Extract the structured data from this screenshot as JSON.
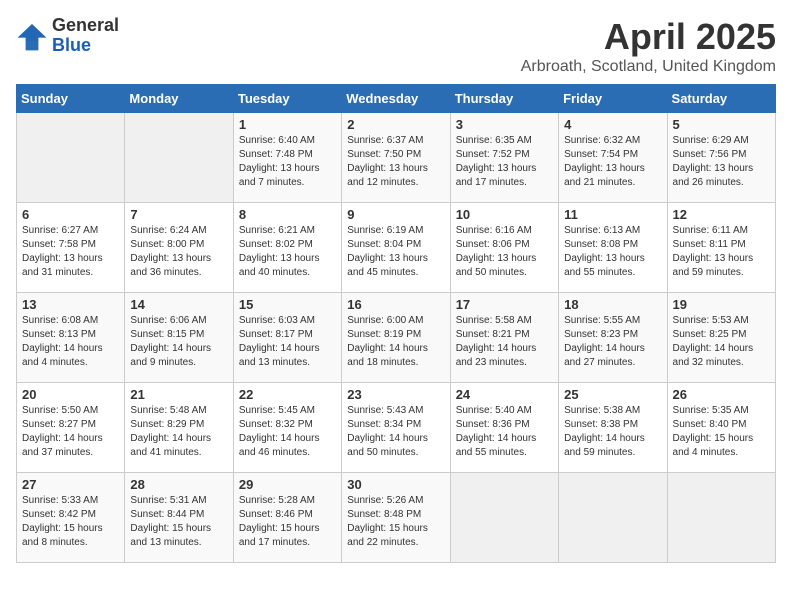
{
  "logo": {
    "general": "General",
    "blue": "Blue"
  },
  "title": "April 2025",
  "subtitle": "Arbroath, Scotland, United Kingdom",
  "days_of_week": [
    "Sunday",
    "Monday",
    "Tuesday",
    "Wednesday",
    "Thursday",
    "Friday",
    "Saturday"
  ],
  "weeks": [
    [
      {
        "day": "",
        "sunrise": "",
        "sunset": "",
        "daylight": "",
        "empty": true
      },
      {
        "day": "",
        "sunrise": "",
        "sunset": "",
        "daylight": "",
        "empty": true
      },
      {
        "day": "1",
        "sunrise": "Sunrise: 6:40 AM",
        "sunset": "Sunset: 7:48 PM",
        "daylight": "Daylight: 13 hours and 7 minutes."
      },
      {
        "day": "2",
        "sunrise": "Sunrise: 6:37 AM",
        "sunset": "Sunset: 7:50 PM",
        "daylight": "Daylight: 13 hours and 12 minutes."
      },
      {
        "day": "3",
        "sunrise": "Sunrise: 6:35 AM",
        "sunset": "Sunset: 7:52 PM",
        "daylight": "Daylight: 13 hours and 17 minutes."
      },
      {
        "day": "4",
        "sunrise": "Sunrise: 6:32 AM",
        "sunset": "Sunset: 7:54 PM",
        "daylight": "Daylight: 13 hours and 21 minutes."
      },
      {
        "day": "5",
        "sunrise": "Sunrise: 6:29 AM",
        "sunset": "Sunset: 7:56 PM",
        "daylight": "Daylight: 13 hours and 26 minutes."
      }
    ],
    [
      {
        "day": "6",
        "sunrise": "Sunrise: 6:27 AM",
        "sunset": "Sunset: 7:58 PM",
        "daylight": "Daylight: 13 hours and 31 minutes."
      },
      {
        "day": "7",
        "sunrise": "Sunrise: 6:24 AM",
        "sunset": "Sunset: 8:00 PM",
        "daylight": "Daylight: 13 hours and 36 minutes."
      },
      {
        "day": "8",
        "sunrise": "Sunrise: 6:21 AM",
        "sunset": "Sunset: 8:02 PM",
        "daylight": "Daylight: 13 hours and 40 minutes."
      },
      {
        "day": "9",
        "sunrise": "Sunrise: 6:19 AM",
        "sunset": "Sunset: 8:04 PM",
        "daylight": "Daylight: 13 hours and 45 minutes."
      },
      {
        "day": "10",
        "sunrise": "Sunrise: 6:16 AM",
        "sunset": "Sunset: 8:06 PM",
        "daylight": "Daylight: 13 hours and 50 minutes."
      },
      {
        "day": "11",
        "sunrise": "Sunrise: 6:13 AM",
        "sunset": "Sunset: 8:08 PM",
        "daylight": "Daylight: 13 hours and 55 minutes."
      },
      {
        "day": "12",
        "sunrise": "Sunrise: 6:11 AM",
        "sunset": "Sunset: 8:11 PM",
        "daylight": "Daylight: 13 hours and 59 minutes."
      }
    ],
    [
      {
        "day": "13",
        "sunrise": "Sunrise: 6:08 AM",
        "sunset": "Sunset: 8:13 PM",
        "daylight": "Daylight: 14 hours and 4 minutes."
      },
      {
        "day": "14",
        "sunrise": "Sunrise: 6:06 AM",
        "sunset": "Sunset: 8:15 PM",
        "daylight": "Daylight: 14 hours and 9 minutes."
      },
      {
        "day": "15",
        "sunrise": "Sunrise: 6:03 AM",
        "sunset": "Sunset: 8:17 PM",
        "daylight": "Daylight: 14 hours and 13 minutes."
      },
      {
        "day": "16",
        "sunrise": "Sunrise: 6:00 AM",
        "sunset": "Sunset: 8:19 PM",
        "daylight": "Daylight: 14 hours and 18 minutes."
      },
      {
        "day": "17",
        "sunrise": "Sunrise: 5:58 AM",
        "sunset": "Sunset: 8:21 PM",
        "daylight": "Daylight: 14 hours and 23 minutes."
      },
      {
        "day": "18",
        "sunrise": "Sunrise: 5:55 AM",
        "sunset": "Sunset: 8:23 PM",
        "daylight": "Daylight: 14 hours and 27 minutes."
      },
      {
        "day": "19",
        "sunrise": "Sunrise: 5:53 AM",
        "sunset": "Sunset: 8:25 PM",
        "daylight": "Daylight: 14 hours and 32 minutes."
      }
    ],
    [
      {
        "day": "20",
        "sunrise": "Sunrise: 5:50 AM",
        "sunset": "Sunset: 8:27 PM",
        "daylight": "Daylight: 14 hours and 37 minutes."
      },
      {
        "day": "21",
        "sunrise": "Sunrise: 5:48 AM",
        "sunset": "Sunset: 8:29 PM",
        "daylight": "Daylight: 14 hours and 41 minutes."
      },
      {
        "day": "22",
        "sunrise": "Sunrise: 5:45 AM",
        "sunset": "Sunset: 8:32 PM",
        "daylight": "Daylight: 14 hours and 46 minutes."
      },
      {
        "day": "23",
        "sunrise": "Sunrise: 5:43 AM",
        "sunset": "Sunset: 8:34 PM",
        "daylight": "Daylight: 14 hours and 50 minutes."
      },
      {
        "day": "24",
        "sunrise": "Sunrise: 5:40 AM",
        "sunset": "Sunset: 8:36 PM",
        "daylight": "Daylight: 14 hours and 55 minutes."
      },
      {
        "day": "25",
        "sunrise": "Sunrise: 5:38 AM",
        "sunset": "Sunset: 8:38 PM",
        "daylight": "Daylight: 14 hours and 59 minutes."
      },
      {
        "day": "26",
        "sunrise": "Sunrise: 5:35 AM",
        "sunset": "Sunset: 8:40 PM",
        "daylight": "Daylight: 15 hours and 4 minutes."
      }
    ],
    [
      {
        "day": "27",
        "sunrise": "Sunrise: 5:33 AM",
        "sunset": "Sunset: 8:42 PM",
        "daylight": "Daylight: 15 hours and 8 minutes."
      },
      {
        "day": "28",
        "sunrise": "Sunrise: 5:31 AM",
        "sunset": "Sunset: 8:44 PM",
        "daylight": "Daylight: 15 hours and 13 minutes."
      },
      {
        "day": "29",
        "sunrise": "Sunrise: 5:28 AM",
        "sunset": "Sunset: 8:46 PM",
        "daylight": "Daylight: 15 hours and 17 minutes."
      },
      {
        "day": "30",
        "sunrise": "Sunrise: 5:26 AM",
        "sunset": "Sunset: 8:48 PM",
        "daylight": "Daylight: 15 hours and 22 minutes."
      },
      {
        "day": "",
        "sunrise": "",
        "sunset": "",
        "daylight": "",
        "empty": true
      },
      {
        "day": "",
        "sunrise": "",
        "sunset": "",
        "daylight": "",
        "empty": true
      },
      {
        "day": "",
        "sunrise": "",
        "sunset": "",
        "daylight": "",
        "empty": true
      }
    ]
  ]
}
